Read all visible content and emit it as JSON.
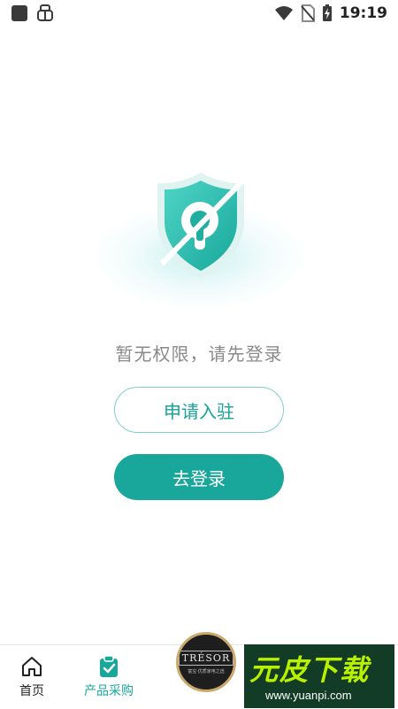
{
  "status_bar": {
    "time": "19:19",
    "left_icons": [
      "square-notification-icon",
      "bug-icon"
    ],
    "right_icons": [
      "wifi-icon",
      "no-sim-icon",
      "battery-charging-icon"
    ]
  },
  "empty_state": {
    "icon": "shield-keyhole-slashed-icon",
    "message": "暂无权限，请先登录"
  },
  "actions": {
    "apply_label": "申请入驻",
    "login_label": "去登录"
  },
  "tabbar": {
    "tabs": [
      {
        "label": "首页",
        "icon": "home-icon",
        "active": false
      },
      {
        "label": "产品采购",
        "icon": "clipboard-check-icon",
        "active": true
      }
    ]
  },
  "brand_badge": {
    "title": "TRÉSOR",
    "subtitle": "富宝·优质家电之选"
  },
  "watermark": {
    "title": "元皮下载",
    "url": "www.yuanpi.com"
  },
  "colors": {
    "accent": "#1aa79b",
    "outline": "#7fcfc8",
    "muted_text": "#8a8a8a",
    "watermark_bg": "#123c26",
    "watermark_title": "#b8f000"
  }
}
